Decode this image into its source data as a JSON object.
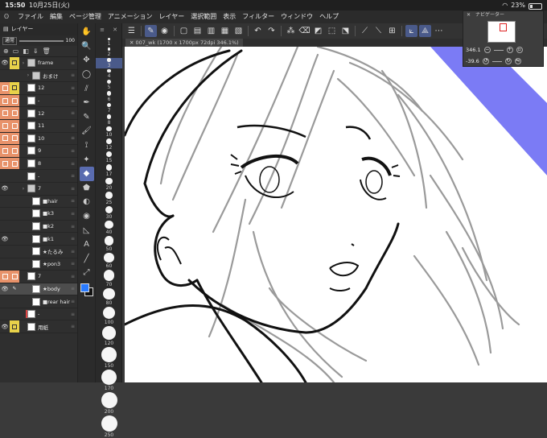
{
  "status": {
    "time": "15:50",
    "date": "10月25日(火)",
    "battery": "23%",
    "battery_level": 0.23
  },
  "menu": [
    "ファイル",
    "編集",
    "ページ管理",
    "アニメーション",
    "レイヤー",
    "選択範囲",
    "表示",
    "フィルター",
    "ウィンドウ",
    "ヘルプ"
  ],
  "layer_panel": {
    "title": "レイヤー",
    "blend_mode": "通常",
    "opacity": "100",
    "layers": [
      {
        "name": "frame",
        "vis": "eye",
        "lock": "yellow",
        "thumb": "folder"
      },
      {
        "name": "おまけ",
        "vis": "",
        "lock": "",
        "thumb": "folder",
        "indent": true
      },
      {
        "name": "12",
        "vis": "orange",
        "lock": "yellow",
        "thumb": "page"
      },
      {
        "name": "-",
        "vis": "orange",
        "lock": "orange",
        "thumb": "page"
      },
      {
        "name": "12",
        "vis": "orange",
        "lock": "orange",
        "thumb": "page"
      },
      {
        "name": "11",
        "vis": "orange",
        "lock": "orange",
        "thumb": "page"
      },
      {
        "name": "10",
        "vis": "orange",
        "lock": "orange",
        "thumb": "page"
      },
      {
        "name": "9",
        "vis": "orange",
        "lock": "orange",
        "thumb": "page"
      },
      {
        "name": "8",
        "vis": "orange",
        "lock": "orange",
        "thumb": "page"
      },
      {
        "name": "-",
        "vis": "",
        "lock": "",
        "thumb": "page"
      },
      {
        "name": "7",
        "vis": "eye",
        "lock": "",
        "thumb": "folder"
      },
      {
        "name": "■hair",
        "vis": "",
        "lock": "",
        "thumb": "page",
        "indent": true
      },
      {
        "name": "■k3",
        "vis": "",
        "lock": "",
        "thumb": "page",
        "indent": true
      },
      {
        "name": "■k2",
        "vis": "",
        "lock": "",
        "thumb": "page",
        "indent": true
      },
      {
        "name": "■k1",
        "vis": "eye",
        "lock": "",
        "thumb": "page",
        "indent": true
      },
      {
        "name": "★たるみ",
        "vis": "",
        "lock": "",
        "thumb": "page",
        "indent": true
      },
      {
        "name": "★pon3",
        "vis": "",
        "lock": "",
        "thumb": "page",
        "indent": true
      },
      {
        "name": "7",
        "vis": "orange",
        "lock": "orange",
        "thumb": "page"
      },
      {
        "name": "★body",
        "vis": "eye",
        "lock": "brush",
        "thumb": "page",
        "indent": true,
        "selected": true
      },
      {
        "name": "■rear hair",
        "vis": "",
        "lock": "",
        "thumb": "page",
        "indent": true
      },
      {
        "name": "-",
        "vis": "",
        "lock": "",
        "thumb": "page",
        "bar": true
      },
      {
        "name": "用紙",
        "vis": "eye",
        "lock": "yellow",
        "thumb": "paper"
      }
    ]
  },
  "tools": [
    "hand-icon",
    "zoom-icon",
    "move-icon",
    "lasso-icon",
    "eyedropper-icon",
    "pen-icon",
    "pencil-icon",
    "brush-icon",
    "airbrush-icon",
    "decoration-icon",
    "eraser-icon",
    "fill-icon",
    "gradient-icon",
    "blend-icon",
    "figure-icon",
    "text-icon",
    "ruler-icon",
    "vector-icon"
  ],
  "tool_glyphs": [
    "✋",
    "🔍",
    "✥",
    "◯",
    "⫽",
    "✒",
    "✎",
    "🖌",
    "⟟",
    "✦",
    "◆",
    "⬟",
    "◐",
    "◉",
    "◺",
    "A",
    "╱",
    "⤢"
  ],
  "selected_tool": 10,
  "colors": {
    "foreground": "#2a7bff",
    "background": "#111111"
  },
  "sizes": [
    "1",
    "2",
    "3",
    "4",
    "5",
    "6",
    "7",
    "8",
    "10",
    "12",
    "15",
    "17",
    "20",
    "25",
    "30",
    "40",
    "50",
    "60",
    "70",
    "80",
    "100",
    "120",
    "150",
    "170",
    "200",
    "250"
  ],
  "selected_size": "3",
  "canvas": {
    "tab_title": "007_wk (1700 x 1700px 72dpi 346.1%)"
  },
  "navigator": {
    "title": "ナビゲーター",
    "zoom": "346.1",
    "rotation": "-39.6"
  }
}
